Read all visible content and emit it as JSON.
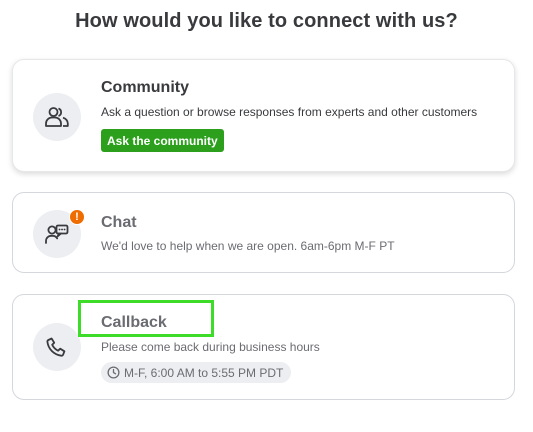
{
  "heading": "How would you like to connect with us?",
  "community": {
    "title": "Community",
    "description": "Ask a question or browse responses from experts and other customers",
    "button": "Ask the community",
    "icon": "people-icon"
  },
  "chat": {
    "title": "Chat",
    "description": "We'd love to help when we are open. 6am-6pm M-F PT",
    "badge": "!",
    "icon": "chat-agent-icon"
  },
  "callback": {
    "title": "Callback",
    "description": "Please come back during business hours",
    "hours": "M-F, 6:00 AM to 5:55 PM PDT",
    "icon": "phone-icon"
  },
  "colors": {
    "accent_green": "#2ca01c",
    "badge_orange": "#ef6c00",
    "highlight_green": "#3ddc28"
  }
}
